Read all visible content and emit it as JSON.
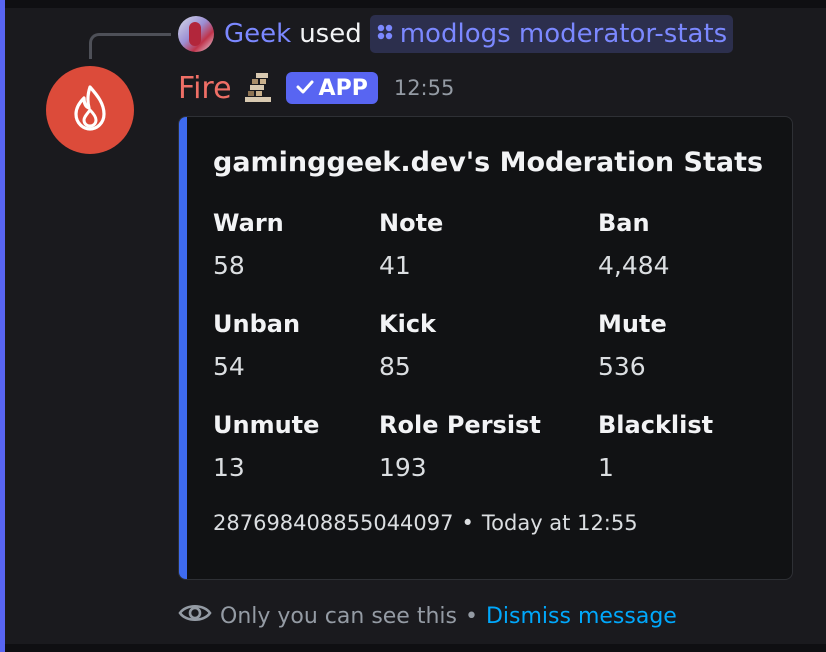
{
  "reply": {
    "user": "Geek",
    "used_text": "used",
    "command": "modlogs moderator-stats"
  },
  "message": {
    "author": "Fire",
    "badge": "APP",
    "timestamp": "12:55"
  },
  "embed": {
    "title": "gaminggeek.dev's Moderation Stats",
    "fields": [
      {
        "name": "Warn",
        "value": "58"
      },
      {
        "name": "Note",
        "value": "41"
      },
      {
        "name": "Ban",
        "value": "4,484"
      },
      {
        "name": "Unban",
        "value": "54"
      },
      {
        "name": "Kick",
        "value": "85"
      },
      {
        "name": "Mute",
        "value": "536"
      },
      {
        "name": "Unmute",
        "value": "13"
      },
      {
        "name": "Role Persist",
        "value": "193"
      },
      {
        "name": "Blacklist",
        "value": "1"
      }
    ],
    "footer": {
      "id": "287698408855044097",
      "separator": "•",
      "time": "Today at 12:55"
    },
    "accent_color": "#3e6bf0"
  },
  "ephemeral": {
    "text": "Only you can see this",
    "separator": "•",
    "dismiss_label": "Dismiss message"
  },
  "colors": {
    "background": "#1a1a1e",
    "blurple": "#5865f2",
    "bot_name": "#ef6f66",
    "link": "#00a8fc",
    "avatar": "#dc4b3a"
  },
  "icons": {
    "command": "slash-command-icon",
    "badge": "checkmark-icon",
    "avatar": "flame-icon",
    "eye": "eye-icon"
  }
}
